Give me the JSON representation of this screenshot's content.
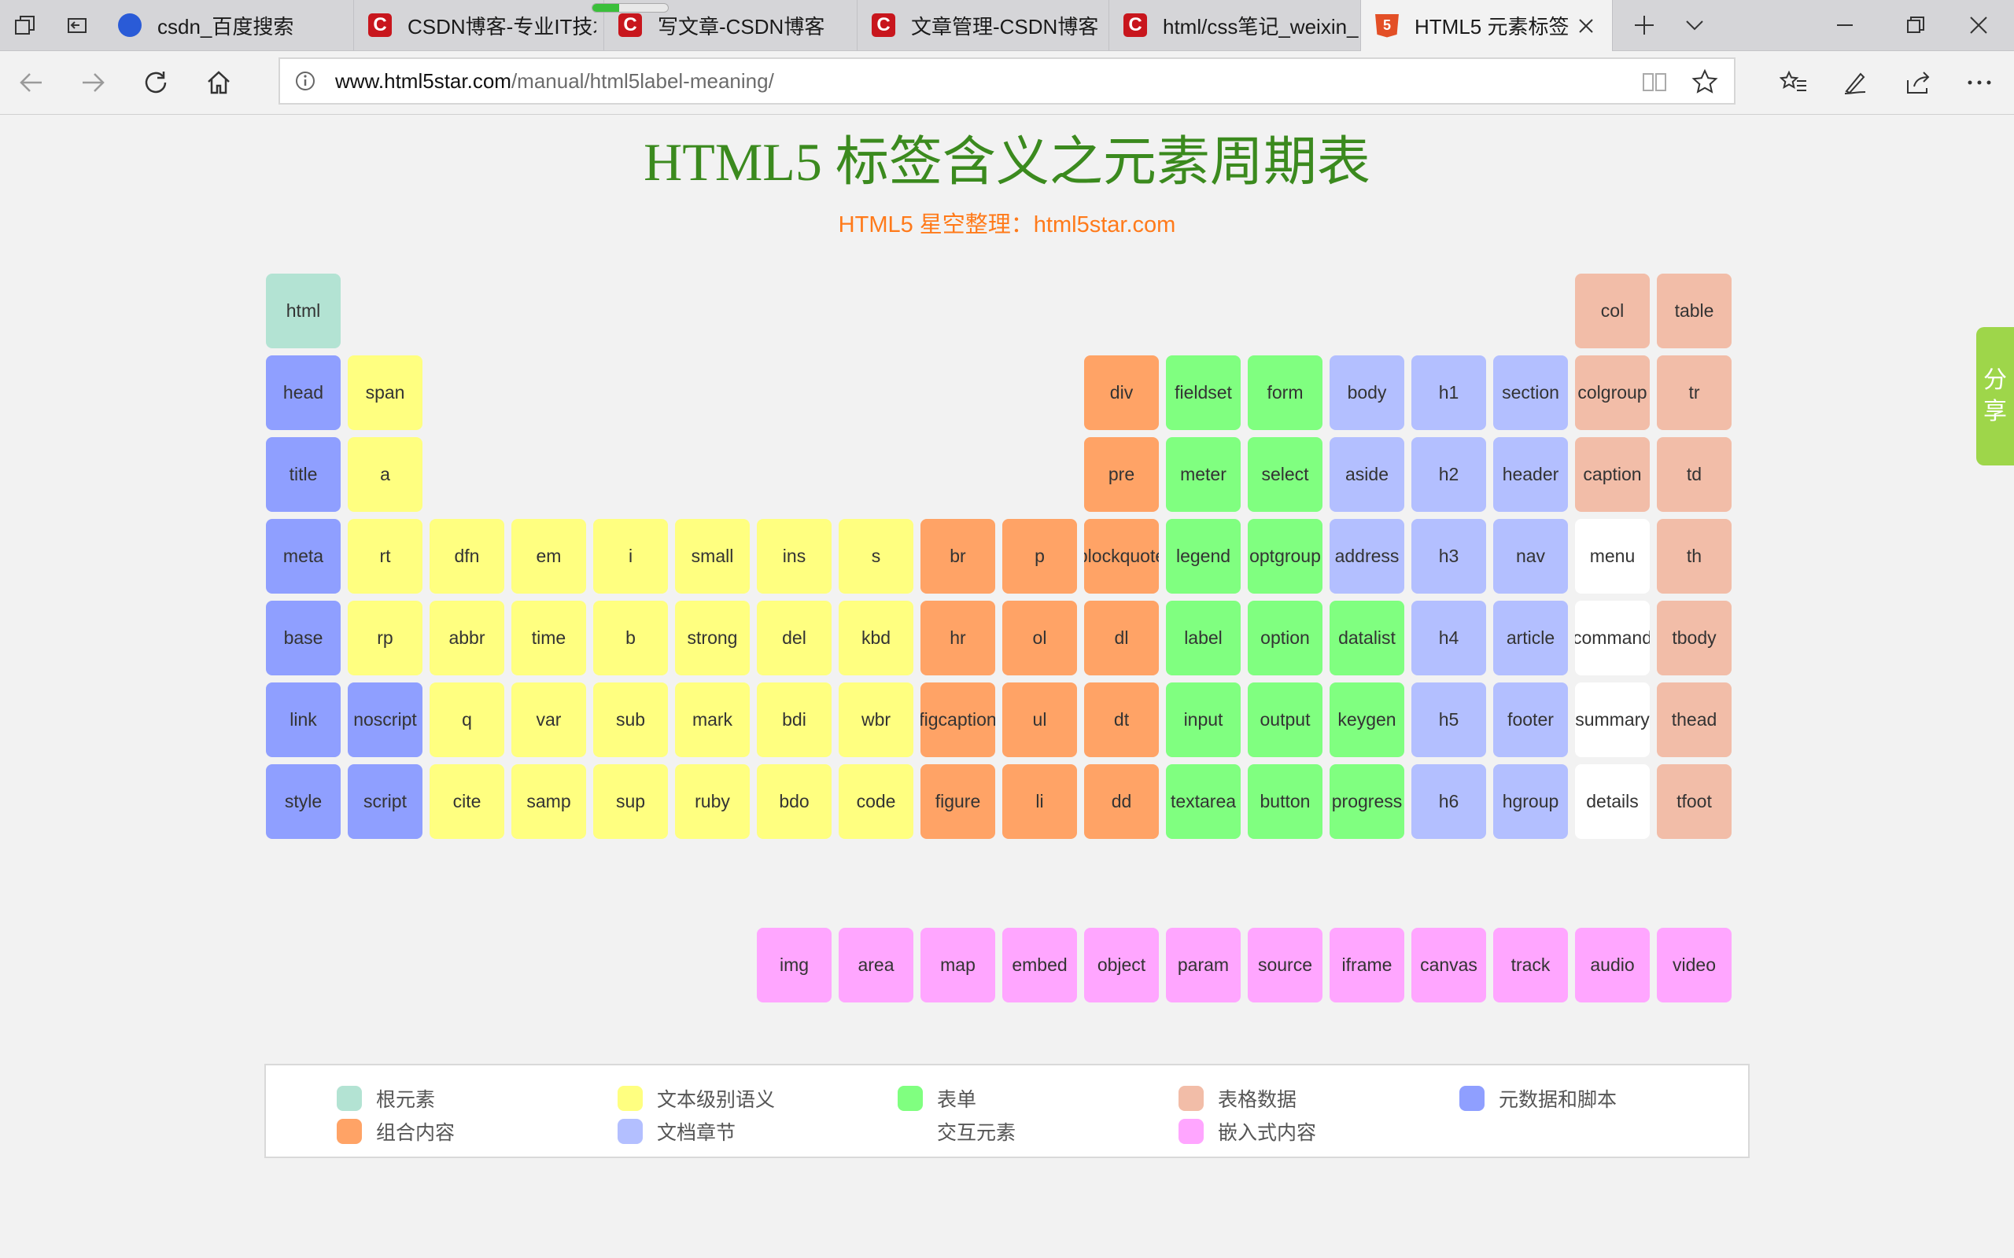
{
  "tabs": [
    {
      "title": "csdn_百度搜索",
      "favicon": "baidu-paw-icon"
    },
    {
      "title": "CSDN博客-专业IT技术",
      "favicon": "csdn-icon"
    },
    {
      "title": "写文章-CSDN博客",
      "favicon": "csdn-icon"
    },
    {
      "title": "文章管理-CSDN博客",
      "favicon": "csdn-icon"
    },
    {
      "title": "html/css笔记_weixin_",
      "favicon": "csdn-icon"
    },
    {
      "title": "HTML5 元素标签",
      "favicon": "html5-icon",
      "active": true
    }
  ],
  "address": {
    "domain": "www.html5star.com",
    "path": "/manual/html5label-meaning/"
  },
  "page": {
    "title": "HTML5 标签含义之元素周期表",
    "subtitle": "HTML5 星空整理：html5star.com"
  },
  "share_label": "分享",
  "categories": {
    "root": {
      "label": "根元素",
      "color": "#b3e3d3"
    },
    "text": {
      "label": "文本级别语义",
      "color": "#ffff80"
    },
    "form": {
      "label": "表单",
      "color": "#80ff80"
    },
    "table": {
      "label": "表格数据",
      "color": "#f2bda8"
    },
    "meta": {
      "label": "元数据和脚本",
      "color": "#8f9fff"
    },
    "group": {
      "label": "组合内容",
      "color": "#ffa366"
    },
    "section": {
      "label": "文档章节",
      "color": "#b3bfff"
    },
    "interactive": {
      "label": "交互元素",
      "color": "#ffffff"
    },
    "embed": {
      "label": "嵌入式内容",
      "color": "#ffa6ff"
    }
  },
  "legend_order": [
    "root",
    "text",
    "form",
    "table",
    "meta",
    "group",
    "section",
    "interactive",
    "embed"
  ],
  "elements": [
    {
      "tag": "html",
      "cat": "root",
      "col": 0,
      "row": 0
    },
    {
      "tag": "col",
      "cat": "table",
      "col": 16,
      "row": 0
    },
    {
      "tag": "table",
      "cat": "table",
      "col": 17,
      "row": 0
    },
    {
      "tag": "head",
      "cat": "meta",
      "col": 0,
      "row": 1
    },
    {
      "tag": "span",
      "cat": "text",
      "col": 1,
      "row": 1
    },
    {
      "tag": "div",
      "cat": "group",
      "col": 10,
      "row": 1
    },
    {
      "tag": "fieldset",
      "cat": "form",
      "col": 11,
      "row": 1
    },
    {
      "tag": "form",
      "cat": "form",
      "col": 12,
      "row": 1
    },
    {
      "tag": "body",
      "cat": "section",
      "col": 13,
      "row": 1
    },
    {
      "tag": "h1",
      "cat": "section",
      "col": 14,
      "row": 1
    },
    {
      "tag": "section",
      "cat": "section",
      "col": 15,
      "row": 1
    },
    {
      "tag": "colgroup",
      "cat": "table",
      "col": 16,
      "row": 1
    },
    {
      "tag": "tr",
      "cat": "table",
      "col": 17,
      "row": 1
    },
    {
      "tag": "title",
      "cat": "meta",
      "col": 0,
      "row": 2
    },
    {
      "tag": "a",
      "cat": "text",
      "col": 1,
      "row": 2
    },
    {
      "tag": "pre",
      "cat": "group",
      "col": 10,
      "row": 2
    },
    {
      "tag": "meter",
      "cat": "form",
      "col": 11,
      "row": 2
    },
    {
      "tag": "select",
      "cat": "form",
      "col": 12,
      "row": 2
    },
    {
      "tag": "aside",
      "cat": "section",
      "col": 13,
      "row": 2
    },
    {
      "tag": "h2",
      "cat": "section",
      "col": 14,
      "row": 2
    },
    {
      "tag": "header",
      "cat": "section",
      "col": 15,
      "row": 2
    },
    {
      "tag": "caption",
      "cat": "table",
      "col": 16,
      "row": 2
    },
    {
      "tag": "td",
      "cat": "table",
      "col": 17,
      "row": 2
    },
    {
      "tag": "meta",
      "cat": "meta",
      "col": 0,
      "row": 3
    },
    {
      "tag": "rt",
      "cat": "text",
      "col": 1,
      "row": 3
    },
    {
      "tag": "dfn",
      "cat": "text",
      "col": 2,
      "row": 3
    },
    {
      "tag": "em",
      "cat": "text",
      "col": 3,
      "row": 3
    },
    {
      "tag": "i",
      "cat": "text",
      "col": 4,
      "row": 3
    },
    {
      "tag": "small",
      "cat": "text",
      "col": 5,
      "row": 3
    },
    {
      "tag": "ins",
      "cat": "text",
      "col": 6,
      "row": 3
    },
    {
      "tag": "s",
      "cat": "text",
      "col": 7,
      "row": 3
    },
    {
      "tag": "br",
      "cat": "group",
      "col": 8,
      "row": 3
    },
    {
      "tag": "p",
      "cat": "group",
      "col": 9,
      "row": 3
    },
    {
      "tag": "blockquote",
      "cat": "group",
      "col": 10,
      "row": 3
    },
    {
      "tag": "legend",
      "cat": "form",
      "col": 11,
      "row": 3
    },
    {
      "tag": "optgroup",
      "cat": "form",
      "col": 12,
      "row": 3
    },
    {
      "tag": "address",
      "cat": "section",
      "col": 13,
      "row": 3
    },
    {
      "tag": "h3",
      "cat": "section",
      "col": 14,
      "row": 3
    },
    {
      "tag": "nav",
      "cat": "section",
      "col": 15,
      "row": 3
    },
    {
      "tag": "menu",
      "cat": "interactive",
      "col": 16,
      "row": 3
    },
    {
      "tag": "th",
      "cat": "table",
      "col": 17,
      "row": 3
    },
    {
      "tag": "base",
      "cat": "meta",
      "col": 0,
      "row": 4
    },
    {
      "tag": "rp",
      "cat": "text",
      "col": 1,
      "row": 4
    },
    {
      "tag": "abbr",
      "cat": "text",
      "col": 2,
      "row": 4
    },
    {
      "tag": "time",
      "cat": "text",
      "col": 3,
      "row": 4
    },
    {
      "tag": "b",
      "cat": "text",
      "col": 4,
      "row": 4
    },
    {
      "tag": "strong",
      "cat": "text",
      "col": 5,
      "row": 4
    },
    {
      "tag": "del",
      "cat": "text",
      "col": 6,
      "row": 4
    },
    {
      "tag": "kbd",
      "cat": "text",
      "col": 7,
      "row": 4
    },
    {
      "tag": "hr",
      "cat": "group",
      "col": 8,
      "row": 4
    },
    {
      "tag": "ol",
      "cat": "group",
      "col": 9,
      "row": 4
    },
    {
      "tag": "dl",
      "cat": "group",
      "col": 10,
      "row": 4
    },
    {
      "tag": "label",
      "cat": "form",
      "col": 11,
      "row": 4
    },
    {
      "tag": "option",
      "cat": "form",
      "col": 12,
      "row": 4
    },
    {
      "tag": "datalist",
      "cat": "form",
      "col": 13,
      "row": 4
    },
    {
      "tag": "h4",
      "cat": "section",
      "col": 14,
      "row": 4
    },
    {
      "tag": "article",
      "cat": "section",
      "col": 15,
      "row": 4
    },
    {
      "tag": "command",
      "cat": "interactive",
      "col": 16,
      "row": 4
    },
    {
      "tag": "tbody",
      "cat": "table",
      "col": 17,
      "row": 4
    },
    {
      "tag": "link",
      "cat": "meta",
      "col": 0,
      "row": 5
    },
    {
      "tag": "noscript",
      "cat": "meta",
      "col": 1,
      "row": 5
    },
    {
      "tag": "q",
      "cat": "text",
      "col": 2,
      "row": 5
    },
    {
      "tag": "var",
      "cat": "text",
      "col": 3,
      "row": 5
    },
    {
      "tag": "sub",
      "cat": "text",
      "col": 4,
      "row": 5
    },
    {
      "tag": "mark",
      "cat": "text",
      "col": 5,
      "row": 5
    },
    {
      "tag": "bdi",
      "cat": "text",
      "col": 6,
      "row": 5
    },
    {
      "tag": "wbr",
      "cat": "text",
      "col": 7,
      "row": 5
    },
    {
      "tag": "figcaption",
      "cat": "group",
      "col": 8,
      "row": 5
    },
    {
      "tag": "ul",
      "cat": "group",
      "col": 9,
      "row": 5
    },
    {
      "tag": "dt",
      "cat": "group",
      "col": 10,
      "row": 5
    },
    {
      "tag": "input",
      "cat": "form",
      "col": 11,
      "row": 5
    },
    {
      "tag": "output",
      "cat": "form",
      "col": 12,
      "row": 5
    },
    {
      "tag": "keygen",
      "cat": "form",
      "col": 13,
      "row": 5
    },
    {
      "tag": "h5",
      "cat": "section",
      "col": 14,
      "row": 5
    },
    {
      "tag": "footer",
      "cat": "section",
      "col": 15,
      "row": 5
    },
    {
      "tag": "summary",
      "cat": "interactive",
      "col": 16,
      "row": 5
    },
    {
      "tag": "thead",
      "cat": "table",
      "col": 17,
      "row": 5
    },
    {
      "tag": "style",
      "cat": "meta",
      "col": 0,
      "row": 6
    },
    {
      "tag": "script",
      "cat": "meta",
      "col": 1,
      "row": 6
    },
    {
      "tag": "cite",
      "cat": "text",
      "col": 2,
      "row": 6
    },
    {
      "tag": "samp",
      "cat": "text",
      "col": 3,
      "row": 6
    },
    {
      "tag": "sup",
      "cat": "text",
      "col": 4,
      "row": 6
    },
    {
      "tag": "ruby",
      "cat": "text",
      "col": 5,
      "row": 6
    },
    {
      "tag": "bdo",
      "cat": "text",
      "col": 6,
      "row": 6
    },
    {
      "tag": "code",
      "cat": "text",
      "col": 7,
      "row": 6
    },
    {
      "tag": "figure",
      "cat": "group",
      "col": 8,
      "row": 6
    },
    {
      "tag": "li",
      "cat": "group",
      "col": 9,
      "row": 6
    },
    {
      "tag": "dd",
      "cat": "group",
      "col": 10,
      "row": 6
    },
    {
      "tag": "textarea",
      "cat": "form",
      "col": 11,
      "row": 6
    },
    {
      "tag": "button",
      "cat": "form",
      "col": 12,
      "row": 6
    },
    {
      "tag": "progress",
      "cat": "form",
      "col": 13,
      "row": 6
    },
    {
      "tag": "h6",
      "cat": "section",
      "col": 14,
      "row": 6
    },
    {
      "tag": "hgroup",
      "cat": "section",
      "col": 15,
      "row": 6
    },
    {
      "tag": "details",
      "cat": "interactive",
      "col": 16,
      "row": 6
    },
    {
      "tag": "tfoot",
      "cat": "table",
      "col": 17,
      "row": 6
    },
    {
      "tag": "img",
      "cat": "embed",
      "col": 6,
      "row": 8
    },
    {
      "tag": "area",
      "cat": "embed",
      "col": 7,
      "row": 8
    },
    {
      "tag": "map",
      "cat": "embed",
      "col": 8,
      "row": 8
    },
    {
      "tag": "embed",
      "cat": "embed",
      "col": 9,
      "row": 8
    },
    {
      "tag": "object",
      "cat": "embed",
      "col": 10,
      "row": 8
    },
    {
      "tag": "param",
      "cat": "embed",
      "col": 11,
      "row": 8
    },
    {
      "tag": "source",
      "cat": "embed",
      "col": 12,
      "row": 8
    },
    {
      "tag": "iframe",
      "cat": "embed",
      "col": 13,
      "row": 8
    },
    {
      "tag": "canvas",
      "cat": "embed",
      "col": 14,
      "row": 8
    },
    {
      "tag": "track",
      "cat": "embed",
      "col": 15,
      "row": 8
    },
    {
      "tag": "audio",
      "cat": "embed",
      "col": 16,
      "row": 8
    },
    {
      "tag": "video",
      "cat": "embed",
      "col": 17,
      "row": 8
    }
  ]
}
